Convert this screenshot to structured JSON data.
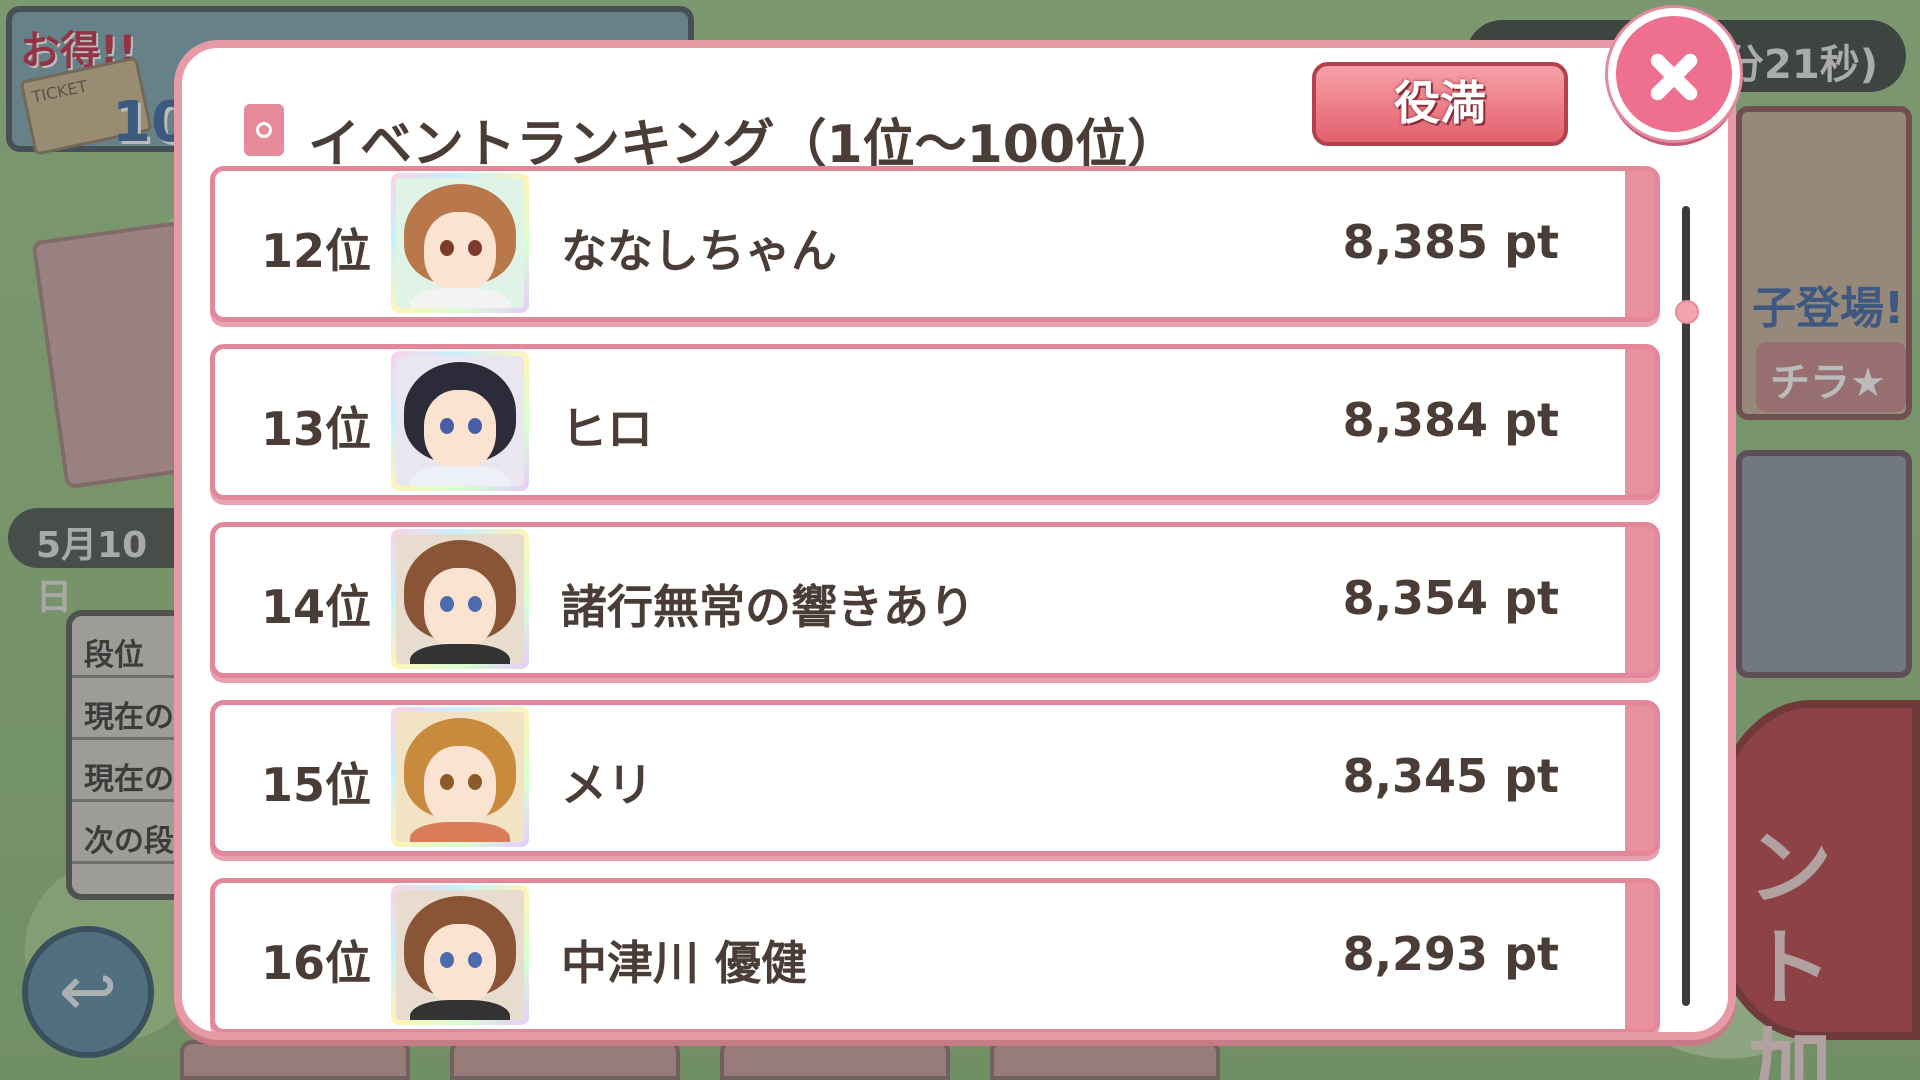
{
  "background": {
    "deal_label": "お得!!",
    "ticket_label": "TICKET",
    "count_label": "10",
    "timer_text": "分21秒)",
    "date_text": "5月10日",
    "rank_panel_items": [
      "段位",
      "現在の",
      "現在の",
      "次の段"
    ],
    "right_card_text": "子登場!",
    "right_card_button": "チラ★",
    "big_button_text": "ント\n加"
  },
  "modal": {
    "title": "イベントランキング（1位～100位）",
    "full_button_label": "役満",
    "rows": [
      {
        "rank": "12位",
        "name": "ななしちゃん",
        "points": "8,385 pt",
        "hair": "#b9784a",
        "eyes": "#7a3b2a",
        "body": "#f3f3f3",
        "bg": "#dff3e7"
      },
      {
        "rank": "13位",
        "name": "ヒロ",
        "points": "8,384 pt",
        "hair": "#2c2b3a",
        "eyes": "#4a5ea8",
        "body": "#eef0f8",
        "bg": "#e9e6ef"
      },
      {
        "rank": "14位",
        "name": "諸行無常の響きあり",
        "points": "8,354 pt",
        "hair": "#8a5536",
        "eyes": "#4c6cb0",
        "body": "#333333",
        "bg": "#e8dccf"
      },
      {
        "rank": "15位",
        "name": "メリ",
        "points": "8,345 pt",
        "hair": "#c88a3c",
        "eyes": "#8a5a2a",
        "body": "#d97c5a",
        "bg": "#f1e3c4"
      },
      {
        "rank": "16位",
        "name": "中津川 優健",
        "points": "8,293 pt",
        "hair": "#8a5536",
        "eyes": "#4c6cb0",
        "body": "#333333",
        "bg": "#e8dccf"
      }
    ]
  },
  "colors": {
    "accent_pink": "#e69aa6",
    "close_pink": "#ee6f8e",
    "text_brown": "#4a3c36"
  }
}
